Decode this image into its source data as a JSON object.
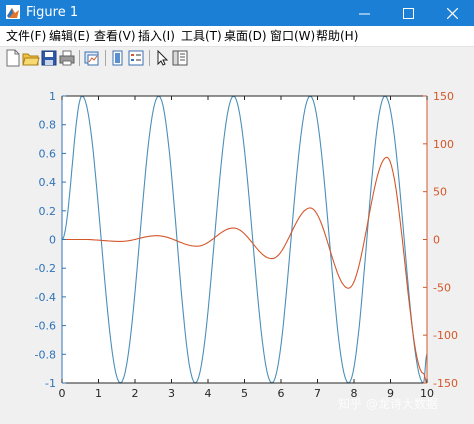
{
  "window": {
    "title": "Figure 1",
    "titlebar_color": "#1b7fd6",
    "controls": [
      "minimize-icon",
      "maximize-icon",
      "close-icon"
    ]
  },
  "menu": {
    "items": [
      "文件(F)",
      "编辑(E)",
      "查看(V)",
      "插入(I)",
      "工具(T)",
      "桌面(D)",
      "窗口(W)",
      "帮助(H)"
    ]
  },
  "toolbar": {
    "icons": [
      "new-figure-icon",
      "open-file-icon",
      "save-icon",
      "print-icon",
      "link-plot-icon",
      "insert-colorbar-icon",
      "insert-legend-icon",
      "pointer-icon",
      "property-inspector-icon"
    ]
  },
  "chart_data": {
    "type": "line",
    "title": "",
    "xlabel": "",
    "ylabel_left": "",
    "ylabel_right": "",
    "xlim": [
      0,
      10
    ],
    "ylim_left": [
      -1,
      1
    ],
    "ylim_right": [
      -150,
      150
    ],
    "x_ticks": [
      "0",
      "1",
      "2",
      "3",
      "4",
      "5",
      "6",
      "7",
      "8",
      "9",
      "10"
    ],
    "y_left_ticks": [
      "-1",
      "-0.8",
      "-0.6",
      "-0.4",
      "-0.2",
      "0",
      "0.2",
      "0.4",
      "0.6",
      "0.8",
      "1"
    ],
    "y_right_ticks": [
      "-150",
      "-100",
      "-50",
      "0",
      "50",
      "100",
      "150"
    ],
    "grid": false,
    "series": [
      {
        "axis": "left",
        "color": "#4a8fb9",
        "x": [
          0,
          0.55,
          1.6,
          2.65,
          3.65,
          4.7,
          5.75,
          6.8,
          7.85,
          8.85,
          9.9,
          10
        ],
        "y": [
          0,
          1,
          -1,
          1,
          -1,
          1,
          -1,
          1,
          -1,
          1,
          -1,
          -0.8
        ]
      },
      {
        "axis": "right",
        "color": "#d4572a",
        "x": [
          0,
          0.6,
          1.6,
          2.6,
          3.7,
          4.7,
          5.75,
          6.8,
          7.85,
          8.9,
          9.9,
          10
        ],
        "y": [
          0,
          0,
          -2,
          4,
          -7,
          12,
          -20,
          33,
          -51,
          86,
          -140,
          -150
        ]
      }
    ]
  },
  "watermark": "知乎 @龙诗大数据"
}
